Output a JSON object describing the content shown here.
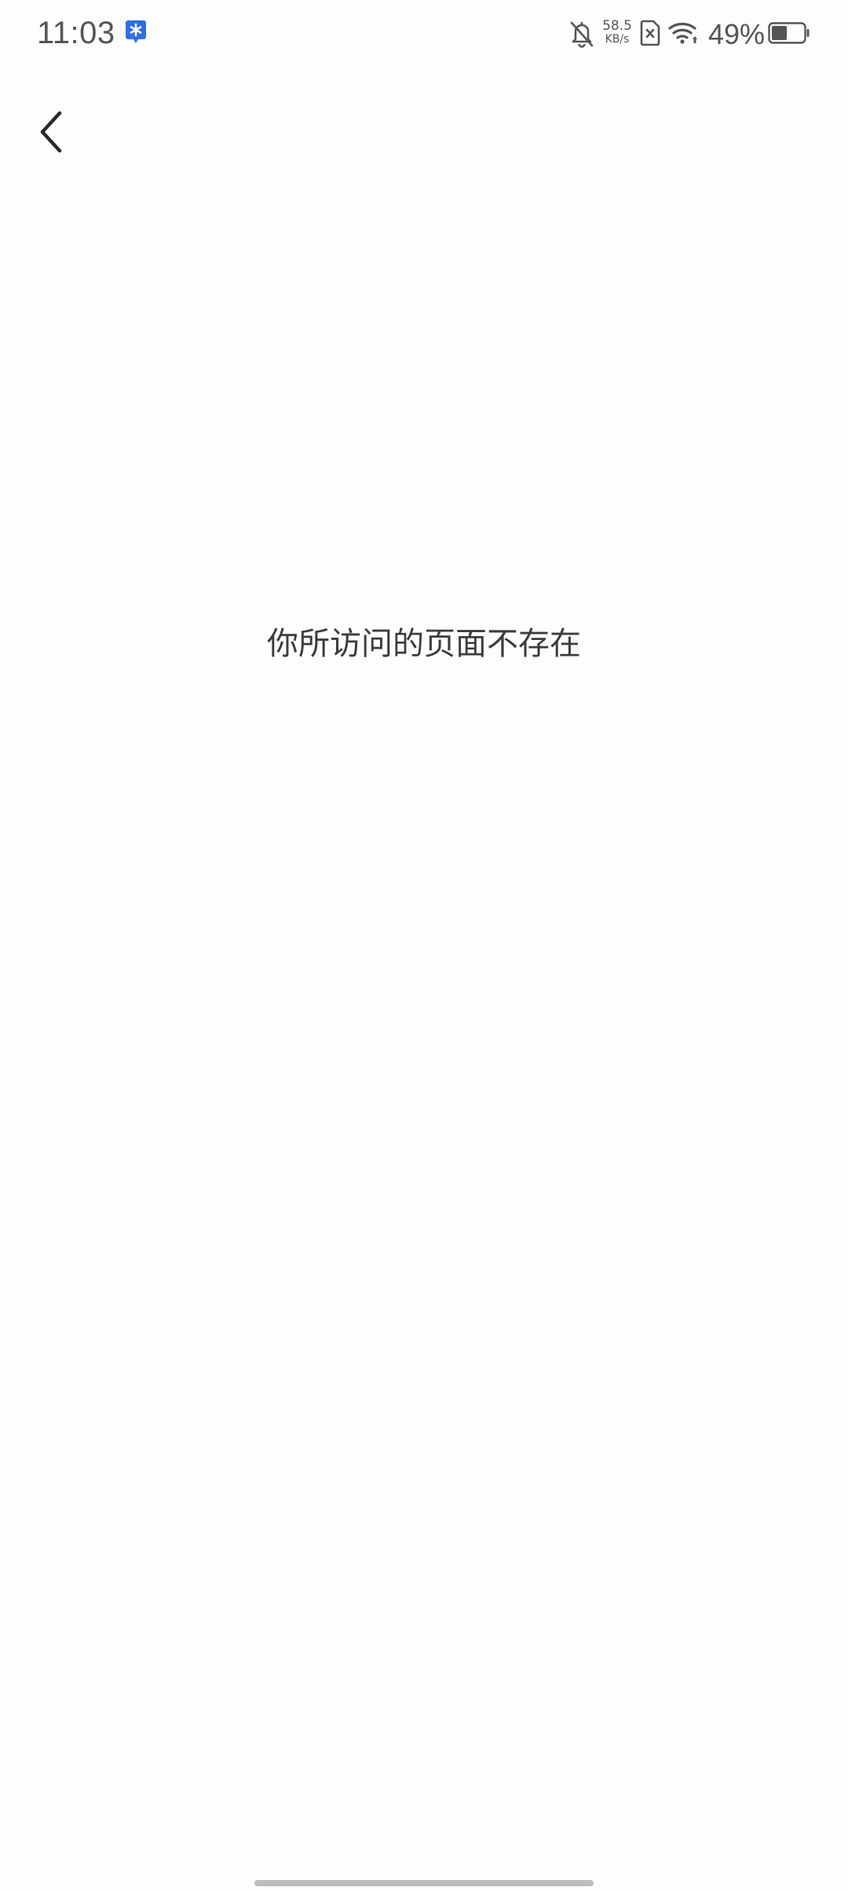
{
  "status_bar": {
    "time": "11:03",
    "net_speed_value": "58.5",
    "net_speed_unit": "KB/s",
    "battery_percent": "49%",
    "battery_level": 0.49,
    "icons": [
      "app-notification-icon",
      "bell-off-icon",
      "sim-error-icon",
      "wifi-icon",
      "battery-icon"
    ],
    "accent_color": "#2f6fe0"
  },
  "nav": {
    "back_icon": "chevron-left-icon"
  },
  "main": {
    "message": "你所访问的页面不存在"
  }
}
